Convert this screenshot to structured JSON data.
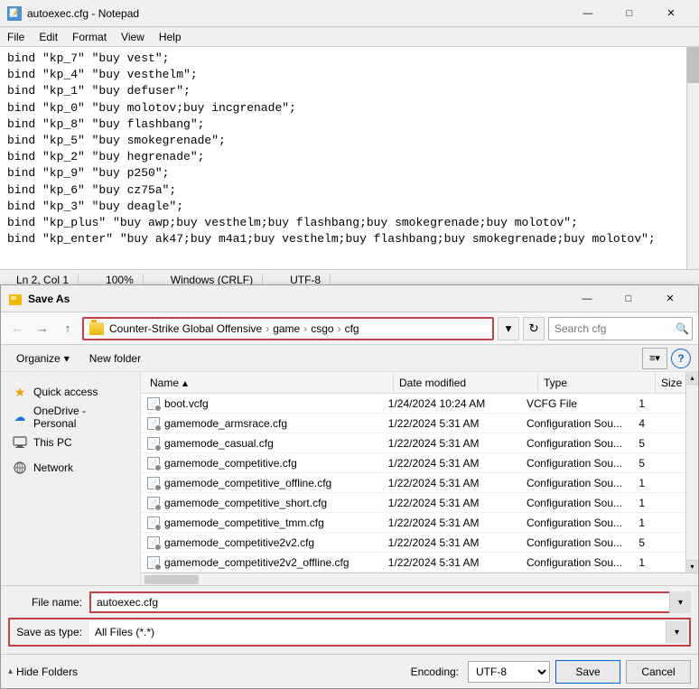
{
  "notepad": {
    "title": "autoexec.cfg - Notepad",
    "menu": [
      "File",
      "Edit",
      "Format",
      "View",
      "Help"
    ],
    "content_lines": [
      "bind \"kp_7\" \"buy vest\";",
      "bind \"kp_4\" \"buy vesthelm\";",
      "bind \"kp_1\" \"buy defuser\";",
      "bind \"kp_0\" \"buy molotov;buy incgrenade\";",
      "bind \"kp_8\" \"buy flashbang\";",
      "bind \"kp_5\" \"buy smokegrenade\";",
      "bind \"kp_2\" \"buy hegrenade\";",
      "bind \"kp_9\" \"buy p250\";",
      "bind \"kp_6\" \"buy cz75a\";",
      "bind \"kp_3\" \"buy deagle\";",
      "bind \"kp_plus\" \"buy awp;buy vesthelm;buy flashbang;buy smokegrenade;buy molotov\";",
      "bind \"kp_enter\" \"buy ak47;buy m4a1;buy vesthelm;buy flashbang;buy smokegrenade;buy molotov\";"
    ],
    "statusbar": {
      "position": "Ln 2, Col 1",
      "zoom": "100%",
      "line_ending": "Windows (CRLF)",
      "encoding": "UTF-8"
    }
  },
  "dialog": {
    "title": "Save As",
    "breadcrumb": {
      "folder_icon": "folder",
      "parts": [
        "Counter-Strike Global Offensive",
        "game",
        "csgo",
        "cfg"
      ]
    },
    "search_placeholder": "Search cfg",
    "toolbar": {
      "organize_label": "Organize",
      "new_folder_label": "New folder",
      "view_icon": "view-icon",
      "help_label": "?"
    },
    "columns": {
      "name": "Name",
      "date_modified": "Date modified",
      "type": "Type",
      "size": "Size"
    },
    "files": [
      {
        "name": "boot.vcfg",
        "date": "1/24/2024 10:24 AM",
        "type": "VCFG File",
        "size": "1"
      },
      {
        "name": "gamemode_armsrace.cfg",
        "date": "1/22/2024 5:31 AM",
        "type": "Configuration Sou...",
        "size": "4"
      },
      {
        "name": "gamemode_casual.cfg",
        "date": "1/22/2024 5:31 AM",
        "type": "Configuration Sou...",
        "size": "5"
      },
      {
        "name": "gamemode_competitive.cfg",
        "date": "1/22/2024 5:31 AM",
        "type": "Configuration Sou...",
        "size": "5"
      },
      {
        "name": "gamemode_competitive_offline.cfg",
        "date": "1/22/2024 5:31 AM",
        "type": "Configuration Sou...",
        "size": "1"
      },
      {
        "name": "gamemode_competitive_short.cfg",
        "date": "1/22/2024 5:31 AM",
        "type": "Configuration Sou...",
        "size": "1"
      },
      {
        "name": "gamemode_competitive_tmm.cfg",
        "date": "1/22/2024 5:31 AM",
        "type": "Configuration Sou...",
        "size": "1"
      },
      {
        "name": "gamemode_competitive2v2.cfg",
        "date": "1/22/2024 5:31 AM",
        "type": "Configuration Sou...",
        "size": "5"
      },
      {
        "name": "gamemode_competitive2v2_offline.cfg",
        "date": "1/22/2024 5:31 AM",
        "type": "Configuration Sou...",
        "size": "1"
      }
    ],
    "sidebar": {
      "items": [
        {
          "label": "Quick access",
          "icon": "quickaccess"
        },
        {
          "label": "OneDrive - Personal",
          "icon": "onedrive"
        },
        {
          "label": "This PC",
          "icon": "thispc"
        },
        {
          "label": "Network",
          "icon": "network"
        }
      ]
    },
    "filename_label": "File name:",
    "filename_value": "autoexec.cfg",
    "savetype_label": "Save as type:",
    "savetype_value": "All Files (*.*)",
    "encoding_label": "Encoding:",
    "encoding_value": "UTF-8",
    "save_button": "Save",
    "cancel_button": "Cancel",
    "hide_folders_label": "Hide Folders"
  }
}
